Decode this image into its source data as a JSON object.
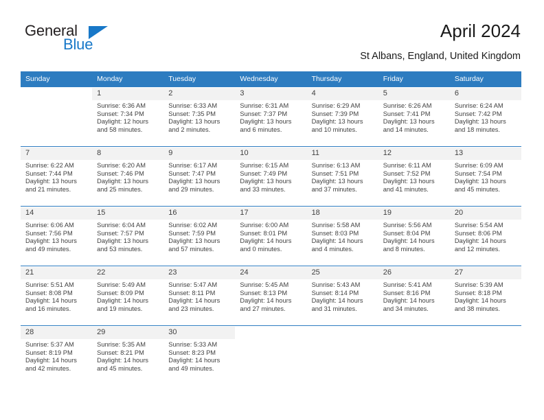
{
  "brand": {
    "name_part1": "General",
    "name_part2": "Blue",
    "accent_color": "#1878c8"
  },
  "header": {
    "title": "April 2024",
    "subtitle": "St Albans, England, United Kingdom"
  },
  "theme": {
    "header_bg": "#2d7cc0",
    "header_text": "#ffffff",
    "date_band_bg": "#f2f2f2",
    "text_color": "#404040"
  },
  "calendar": {
    "weekday_headers": [
      "Sunday",
      "Monday",
      "Tuesday",
      "Wednesday",
      "Thursday",
      "Friday",
      "Saturday"
    ],
    "weeks": [
      {
        "days": [
          {
            "date": "",
            "lines": []
          },
          {
            "date": "1",
            "lines": [
              "Sunrise: 6:36 AM",
              "Sunset: 7:34 PM",
              "Daylight: 12 hours",
              "and 58 minutes."
            ]
          },
          {
            "date": "2",
            "lines": [
              "Sunrise: 6:33 AM",
              "Sunset: 7:35 PM",
              "Daylight: 13 hours",
              "and 2 minutes."
            ]
          },
          {
            "date": "3",
            "lines": [
              "Sunrise: 6:31 AM",
              "Sunset: 7:37 PM",
              "Daylight: 13 hours",
              "and 6 minutes."
            ]
          },
          {
            "date": "4",
            "lines": [
              "Sunrise: 6:29 AM",
              "Sunset: 7:39 PM",
              "Daylight: 13 hours",
              "and 10 minutes."
            ]
          },
          {
            "date": "5",
            "lines": [
              "Sunrise: 6:26 AM",
              "Sunset: 7:41 PM",
              "Daylight: 13 hours",
              "and 14 minutes."
            ]
          },
          {
            "date": "6",
            "lines": [
              "Sunrise: 6:24 AM",
              "Sunset: 7:42 PM",
              "Daylight: 13 hours",
              "and 18 minutes."
            ]
          }
        ]
      },
      {
        "days": [
          {
            "date": "7",
            "lines": [
              "Sunrise: 6:22 AM",
              "Sunset: 7:44 PM",
              "Daylight: 13 hours",
              "and 21 minutes."
            ]
          },
          {
            "date": "8",
            "lines": [
              "Sunrise: 6:20 AM",
              "Sunset: 7:46 PM",
              "Daylight: 13 hours",
              "and 25 minutes."
            ]
          },
          {
            "date": "9",
            "lines": [
              "Sunrise: 6:17 AM",
              "Sunset: 7:47 PM",
              "Daylight: 13 hours",
              "and 29 minutes."
            ]
          },
          {
            "date": "10",
            "lines": [
              "Sunrise: 6:15 AM",
              "Sunset: 7:49 PM",
              "Daylight: 13 hours",
              "and 33 minutes."
            ]
          },
          {
            "date": "11",
            "lines": [
              "Sunrise: 6:13 AM",
              "Sunset: 7:51 PM",
              "Daylight: 13 hours",
              "and 37 minutes."
            ]
          },
          {
            "date": "12",
            "lines": [
              "Sunrise: 6:11 AM",
              "Sunset: 7:52 PM",
              "Daylight: 13 hours",
              "and 41 minutes."
            ]
          },
          {
            "date": "13",
            "lines": [
              "Sunrise: 6:09 AM",
              "Sunset: 7:54 PM",
              "Daylight: 13 hours",
              "and 45 minutes."
            ]
          }
        ]
      },
      {
        "days": [
          {
            "date": "14",
            "lines": [
              "Sunrise: 6:06 AM",
              "Sunset: 7:56 PM",
              "Daylight: 13 hours",
              "and 49 minutes."
            ]
          },
          {
            "date": "15",
            "lines": [
              "Sunrise: 6:04 AM",
              "Sunset: 7:57 PM",
              "Daylight: 13 hours",
              "and 53 minutes."
            ]
          },
          {
            "date": "16",
            "lines": [
              "Sunrise: 6:02 AM",
              "Sunset: 7:59 PM",
              "Daylight: 13 hours",
              "and 57 minutes."
            ]
          },
          {
            "date": "17",
            "lines": [
              "Sunrise: 6:00 AM",
              "Sunset: 8:01 PM",
              "Daylight: 14 hours",
              "and 0 minutes."
            ]
          },
          {
            "date": "18",
            "lines": [
              "Sunrise: 5:58 AM",
              "Sunset: 8:03 PM",
              "Daylight: 14 hours",
              "and 4 minutes."
            ]
          },
          {
            "date": "19",
            "lines": [
              "Sunrise: 5:56 AM",
              "Sunset: 8:04 PM",
              "Daylight: 14 hours",
              "and 8 minutes."
            ]
          },
          {
            "date": "20",
            "lines": [
              "Sunrise: 5:54 AM",
              "Sunset: 8:06 PM",
              "Daylight: 14 hours",
              "and 12 minutes."
            ]
          }
        ]
      },
      {
        "days": [
          {
            "date": "21",
            "lines": [
              "Sunrise: 5:51 AM",
              "Sunset: 8:08 PM",
              "Daylight: 14 hours",
              "and 16 minutes."
            ]
          },
          {
            "date": "22",
            "lines": [
              "Sunrise: 5:49 AM",
              "Sunset: 8:09 PM",
              "Daylight: 14 hours",
              "and 19 minutes."
            ]
          },
          {
            "date": "23",
            "lines": [
              "Sunrise: 5:47 AM",
              "Sunset: 8:11 PM",
              "Daylight: 14 hours",
              "and 23 minutes."
            ]
          },
          {
            "date": "24",
            "lines": [
              "Sunrise: 5:45 AM",
              "Sunset: 8:13 PM",
              "Daylight: 14 hours",
              "and 27 minutes."
            ]
          },
          {
            "date": "25",
            "lines": [
              "Sunrise: 5:43 AM",
              "Sunset: 8:14 PM",
              "Daylight: 14 hours",
              "and 31 minutes."
            ]
          },
          {
            "date": "26",
            "lines": [
              "Sunrise: 5:41 AM",
              "Sunset: 8:16 PM",
              "Daylight: 14 hours",
              "and 34 minutes."
            ]
          },
          {
            "date": "27",
            "lines": [
              "Sunrise: 5:39 AM",
              "Sunset: 8:18 PM",
              "Daylight: 14 hours",
              "and 38 minutes."
            ]
          }
        ]
      },
      {
        "days": [
          {
            "date": "28",
            "lines": [
              "Sunrise: 5:37 AM",
              "Sunset: 8:19 PM",
              "Daylight: 14 hours",
              "and 42 minutes."
            ]
          },
          {
            "date": "29",
            "lines": [
              "Sunrise: 5:35 AM",
              "Sunset: 8:21 PM",
              "Daylight: 14 hours",
              "and 45 minutes."
            ]
          },
          {
            "date": "30",
            "lines": [
              "Sunrise: 5:33 AM",
              "Sunset: 8:23 PM",
              "Daylight: 14 hours",
              "and 49 minutes."
            ]
          },
          {
            "date": "",
            "lines": []
          },
          {
            "date": "",
            "lines": []
          },
          {
            "date": "",
            "lines": []
          },
          {
            "date": "",
            "lines": []
          }
        ]
      }
    ]
  }
}
